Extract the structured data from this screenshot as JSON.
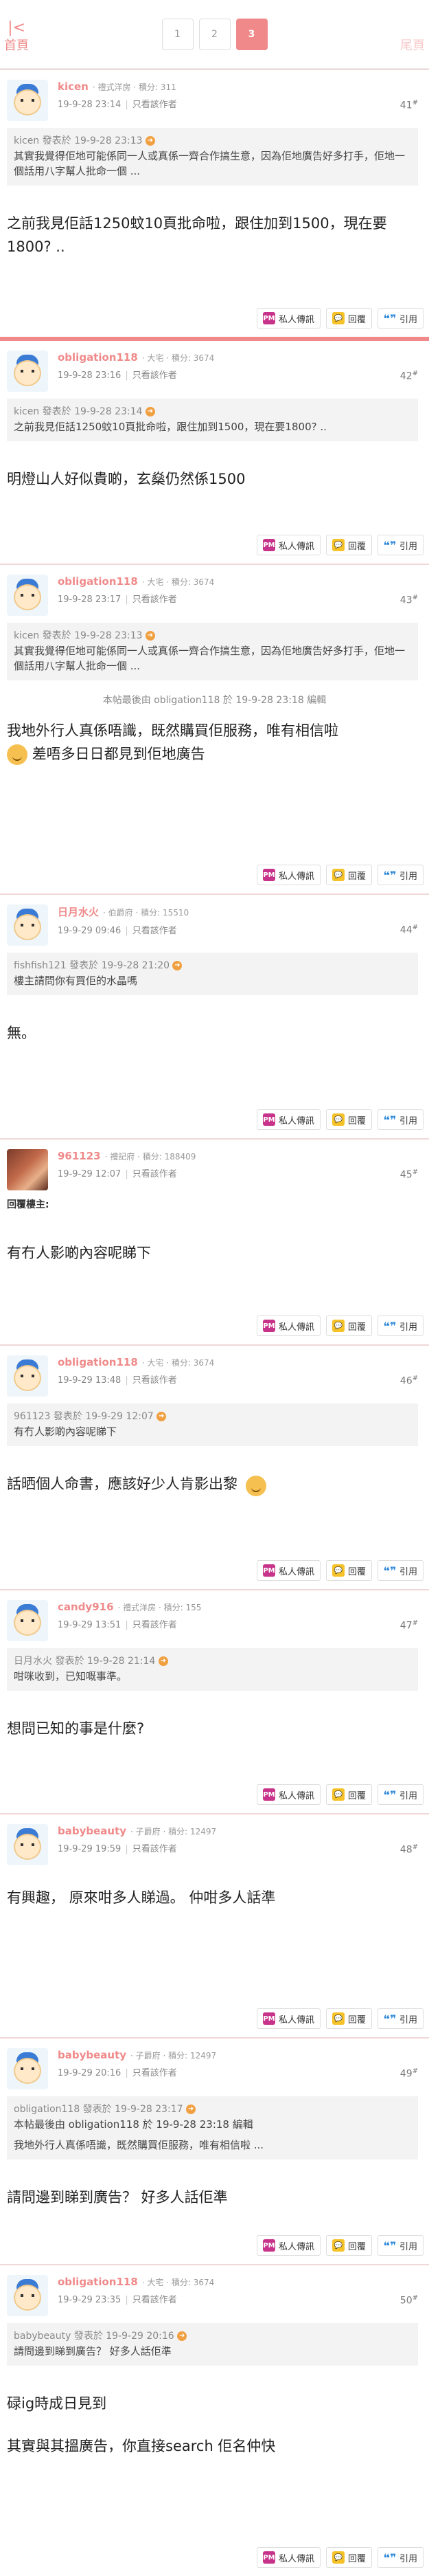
{
  "nav": {
    "home_icon": "home-arrow-icon",
    "home_label": "首頁",
    "last_label": "尾頁"
  },
  "pager": [
    "1",
    "2",
    "3"
  ],
  "actions": {
    "pm": "私人傳訊",
    "reply": "回覆",
    "quote": "引用",
    "pm_icon": "PM",
    "quote_icon": "❝❞"
  },
  "posts": [
    {
      "user": "kicen",
      "rank": "· 禮式洋房 · 積分: 311",
      "time": "19-9-28 23:14",
      "author_only": "只看該作者",
      "floor": "41",
      "quote_head": "kicen 發表於 19-9-28 23:13",
      "quote_body": "其實我覺得佢地可能係同一人或真係一齊合作搞生意，因為佢地廣告好多打手，佢地一個話用八字幫人批命一個 ...",
      "body": "之前我見佢話1250蚊10頁批命啦，跟住加到1500，現在要1800? .."
    },
    {
      "user": "obligation118",
      "rank": "· 大宅 · 積分: 3674",
      "time": "19-9-28 23:16",
      "author_only": "只看該作者",
      "floor": "42",
      "quote_head": "kicen 發表於 19-9-28 23:14",
      "quote_body": "之前我見佢話1250蚊10頁批命啦，跟住加到1500，現在要1800? ..",
      "body": "明燈山人好似貴啲，玄燊仍然係1500"
    },
    {
      "user": "obligation118",
      "rank": "· 大宅 · 積分: 3674",
      "time": "19-9-28 23:17",
      "author_only": "只看該作者",
      "floor": "43",
      "quote_head": "kicen 發表於 19-9-28 23:13",
      "quote_body": "其實我覺得佢地可能係同一人或真係一齊合作搞生意，因為佢地廣告好多打手，佢地一個話用八字幫人批命一個 ...",
      "edit_note": "本帖最後由 obligation118 於 19-9-28 23:18 編輯",
      "body": "我地外行人真係唔識，既然購買佢服務，唯有相信啦",
      "body2": "差唔多日日都見到佢地廣告"
    },
    {
      "user": "日月水火",
      "rank": "· 伯爵府 · 積分: 15510",
      "time": "19-9-29 09:46",
      "author_only": "只看該作者",
      "floor": "44",
      "quote_head": "fishfish121 發表於 19-9-28 21:20",
      "quote_body": "樓主請問你有買佢的水晶嗎",
      "body": "無。"
    },
    {
      "user": "961123",
      "rank": "· 禮記府 · 積分: 188409",
      "time": "19-9-29 12:07",
      "author_only": "只看該作者",
      "floor": "45",
      "reply_label": "回覆樓主:",
      "body": "有冇人影啲內容呢睇下"
    },
    {
      "user": "obligation118",
      "rank": "· 大宅 · 積分: 3674",
      "time": "19-9-29 13:48",
      "author_only": "只看該作者",
      "floor": "46",
      "quote_head": "961123 發表於 19-9-29 12:07",
      "quote_body": "有冇人影啲內容呢睇下",
      "body": "話晒個人命書，應該好少人肯影出黎"
    },
    {
      "user": "candy916",
      "rank": "· 禮式洋房 · 積分: 155",
      "time": "19-9-29 13:51",
      "author_only": "只看該作者",
      "floor": "47",
      "quote_head": "日月水火 發表於 19-9-28 21:14",
      "quote_body": "咁咪收到，已知嘅事準。",
      "body": "想問已知的事是什麼?"
    },
    {
      "user": "babybeauty",
      "rank": "· 子爵府 · 積分: 12497",
      "time": "19-9-29 19:59",
      "author_only": "只看該作者",
      "floor": "48",
      "body": "有興趣， 原來咁多人睇過。 仲咁多人話準"
    },
    {
      "user": "babybeauty",
      "rank": "· 子爵府 · 積分: 12497",
      "time": "19-9-29 20:16",
      "author_only": "只看該作者",
      "floor": "49",
      "quote_head": "obligation118 發表於 19-9-28 23:17",
      "quote_body": "本帖最後由 obligation118 於 19-9-28 23:18 編輯",
      "quote_body2": "我地外行人真係唔識，既然購買佢服務，唯有相信啦 ...",
      "body": "請問邊到睇到廣告？ 好多人話佢準"
    },
    {
      "user": "obligation118",
      "rank": "· 大宅 · 積分: 3674",
      "time": "19-9-29 23:35",
      "author_only": "只看該作者",
      "floor": "50",
      "quote_head": "babybeauty 發表於 19-9-29 20:16",
      "quote_body": "請問邊到睇到廣告？ 好多人話佢準",
      "body": "碌ig時成日見到",
      "body2": "其實與其搵廣告，你直接search 佢名仲快"
    }
  ]
}
